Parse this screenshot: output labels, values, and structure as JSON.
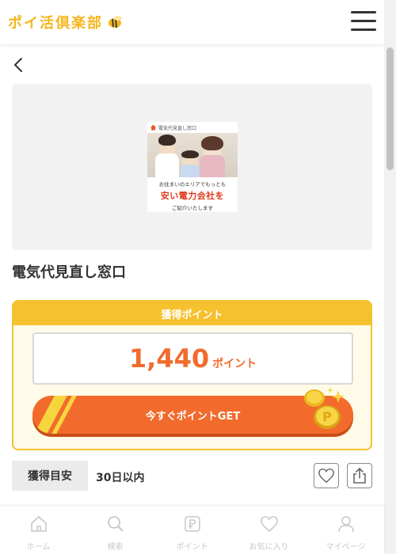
{
  "header": {
    "logo": "ポイ活倶楽部",
    "menu_icon": "hamburger-icon"
  },
  "nav": {
    "back_icon": "chevron-left-icon"
  },
  "banner": {
    "tag": "電気代見直し窓口",
    "line1": "お住まいのエリアでもっとも",
    "line2": "安い電力会社を",
    "line3": "ご紹介いたします"
  },
  "offer": {
    "title": "電気代見直し窓口"
  },
  "points": {
    "heading": "獲得ポイント",
    "value": "1,440",
    "unit": "ポイント",
    "cta": "今すぐポイントGET"
  },
  "eta": {
    "label": "獲得目安",
    "value": "30日以内"
  },
  "actions": {
    "favorite_icon": "heart-icon",
    "share_icon": "share-icon"
  },
  "tabs": [
    {
      "label": "ホーム",
      "icon": "home-icon"
    },
    {
      "label": "検索",
      "icon": "search-icon"
    },
    {
      "label": "ポイント",
      "icon": "point-icon"
    },
    {
      "label": "お気に入り",
      "icon": "heart-icon"
    },
    {
      "label": "マイページ",
      "icon": "user-icon"
    }
  ],
  "colors": {
    "accent": "#f26b2d",
    "brand": "#f5c12e",
    "tab_inactive": "#c8c8c8"
  }
}
